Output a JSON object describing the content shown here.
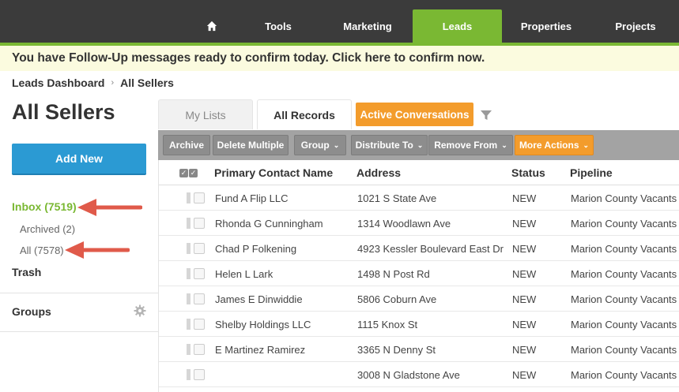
{
  "nav": {
    "items": [
      "Tools",
      "Marketing",
      "Leads",
      "Properties",
      "Projects"
    ],
    "active": "Leads"
  },
  "banner": {
    "text": "You have Follow-Up messages ready to confirm today. Click here to confirm now."
  },
  "breadcrumb": {
    "parent": "Leads Dashboard",
    "separator": "›",
    "current": "All Sellers"
  },
  "page": {
    "title": "All Sellers"
  },
  "tabs": {
    "my_lists": "My Lists",
    "all_records": "All Records",
    "active_conversations": "Active Conversations"
  },
  "toolbar": {
    "archive": "Archive",
    "delete_multiple": "Delete Multiple",
    "group": "Group",
    "distribute_to": "Distribute To",
    "remove_from": "Remove From",
    "more_actions": "More Actions",
    "caret": "⌄"
  },
  "sidebar": {
    "add_new": "Add New",
    "inbox": "Inbox (7519)",
    "archived": "Archived (2)",
    "all": "All (7578)",
    "trash": "Trash",
    "groups": "Groups"
  },
  "table": {
    "columns": [
      "Primary Contact Name",
      "Address",
      "Status",
      "Pipeline"
    ],
    "rows": [
      {
        "name": "Fund A Flip LLC",
        "address": "1021 S State Ave",
        "status": "NEW",
        "pipeline": "Marion County Vacants"
      },
      {
        "name": "Rhonda G Cunningham",
        "address": "1314 Woodlawn Ave",
        "status": "NEW",
        "pipeline": "Marion County Vacants"
      },
      {
        "name": "Chad P Folkening",
        "address": "4923 Kessler Boulevard East Dr",
        "status": "NEW",
        "pipeline": "Marion County Vacants"
      },
      {
        "name": "Helen L Lark",
        "address": "1498 N Post Rd",
        "status": "NEW",
        "pipeline": "Marion County Vacants"
      },
      {
        "name": "James E Dinwiddie",
        "address": "5806 Coburn Ave",
        "status": "NEW",
        "pipeline": "Marion County Vacants"
      },
      {
        "name": "Shelby Holdings LLC",
        "address": "1115 Knox St",
        "status": "NEW",
        "pipeline": "Marion County Vacants"
      },
      {
        "name": "E Martinez Ramirez",
        "address": "3365 N Denny St",
        "status": "NEW",
        "pipeline": "Marion County Vacants"
      },
      {
        "name": "",
        "address": "3008 N Gladstone Ave",
        "status": "NEW",
        "pipeline": "Marion County Vacants"
      }
    ]
  },
  "colors": {
    "nav_bg": "#3b3b3b",
    "brand_green": "#7ab833",
    "banner_bg": "#fbfbdf",
    "add_new_blue": "#2b9ad3",
    "orange": "#f39c2c",
    "annotation_arrow": "#e05a4a"
  },
  "icons": [
    "home-icon",
    "filter-icon",
    "gear-icon",
    "checkbox-icon",
    "drag-handle-icon",
    "annotation-arrow"
  ]
}
